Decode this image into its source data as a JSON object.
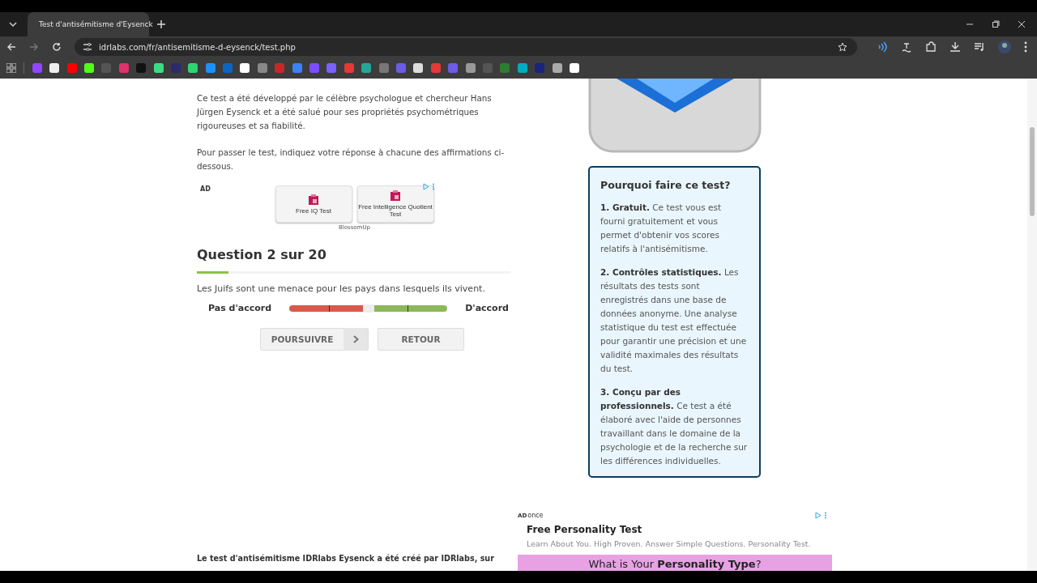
{
  "browser": {
    "tab_title": "Test d'antisémitisme d'Eysenck",
    "url": "idrlabs.com/fr/antisemitisme-d-eysenck/test.php"
  },
  "intro": [
    "Ce test a été développé par le célèbre psychologue et chercheur Hans Jürgen Eysenck et a été salué pour ses propriétés psychométriques rigoureuses et sa fiabilité.",
    "Pour passer le test, indiquez votre réponse à chacune des affirmations ci-dessous."
  ],
  "ad_top": {
    "label": "AD",
    "buttons": [
      "Free IQ Test",
      "Free Intelligence Quotient Test"
    ],
    "sponsor": "BlossomUp"
  },
  "question": {
    "title": "Question 2 sur 20",
    "progress": {
      "level": 0.1
    },
    "statement": "Les Juifs sont une menace pour les pays dans lesquels ils vivent.",
    "left_label": "Pas d'accord",
    "right_label": "D'accord",
    "slider": {
      "level": 0.5
    }
  },
  "buttons": [
    {
      "label": "POURSUIVRE",
      "kind": "next"
    },
    {
      "label": "RETOUR",
      "kind": "back"
    }
  ],
  "info_box": {
    "title": "Pourquoi faire ce test?",
    "items": [
      {
        "heading": "1. Gratuit.",
        "text": "Ce test vous est fourni gratuitement et vous permet d'obtenir vos scores relatifs à l'antisémitisme."
      },
      {
        "heading": "2. Contrôles statistiques.",
        "text": "Les résultats des tests sont enregistrés dans une base de données anonyme. Une analyse statistique du test est effectuée pour garantir une précision et une validité maximales des résultats du test."
      },
      {
        "heading": "3. Conçu par des professionnels.",
        "text": "Ce test a été élaboré avec l'aide de personnes travaillant dans le domaine de la psychologie et de la recherche sur les différences individuelles."
      }
    ]
  },
  "footer_text": "Le test d'antisémitisme IDRlabs Eysenck a été créé par IDRlabs, sur",
  "ad_bottom": {
    "label": "AD",
    "brand": "once",
    "title": "Free Personality Test",
    "description": "Learn About You. High Proven. Answer Simple Questions. Personality Test.",
    "banner": "What is Your **Personality Type**?"
  }
}
